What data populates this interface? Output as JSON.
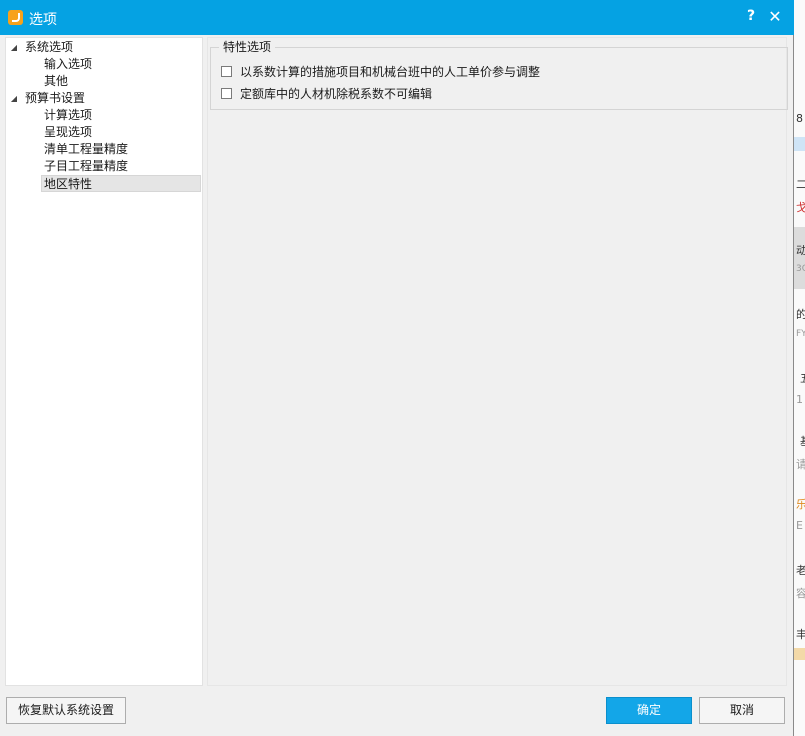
{
  "window": {
    "title": "选项",
    "help_label": "?",
    "close_label": "✕",
    "accent_color": "#05a2e3"
  },
  "tree": {
    "items": [
      {
        "label": "系统选项",
        "level": 0,
        "expanded": true
      },
      {
        "label": "输入选项",
        "level": 1
      },
      {
        "label": "其他",
        "level": 1
      },
      {
        "label": "预算书设置",
        "level": 0,
        "expanded": true
      },
      {
        "label": "计算选项",
        "level": 1
      },
      {
        "label": "呈现选项",
        "level": 1
      },
      {
        "label": "清单工程量精度",
        "level": 1
      },
      {
        "label": "子目工程量精度",
        "level": 1
      },
      {
        "label": "地区特性",
        "level": 1,
        "selected": true
      }
    ],
    "expand_icon": "◢"
  },
  "content": {
    "group_title": "特性选项",
    "options": [
      {
        "label": "以系数计算的措施项目和机械台班中的人工单价参与调整",
        "checked": false
      },
      {
        "label": "定额库中的人材机除税系数不可编辑",
        "checked": false
      }
    ]
  },
  "buttons": {
    "restore_default": "恢复默认系统设置",
    "ok": "确定",
    "cancel": "取消"
  },
  "background_app": {
    "glyphs": [
      "8",
      "二",
      "戈",
      "动",
      "3C",
      "的",
      "FY",
      "五",
      "1",
      "基",
      "请",
      "乐",
      "E",
      "老",
      "容",
      "丰"
    ]
  }
}
